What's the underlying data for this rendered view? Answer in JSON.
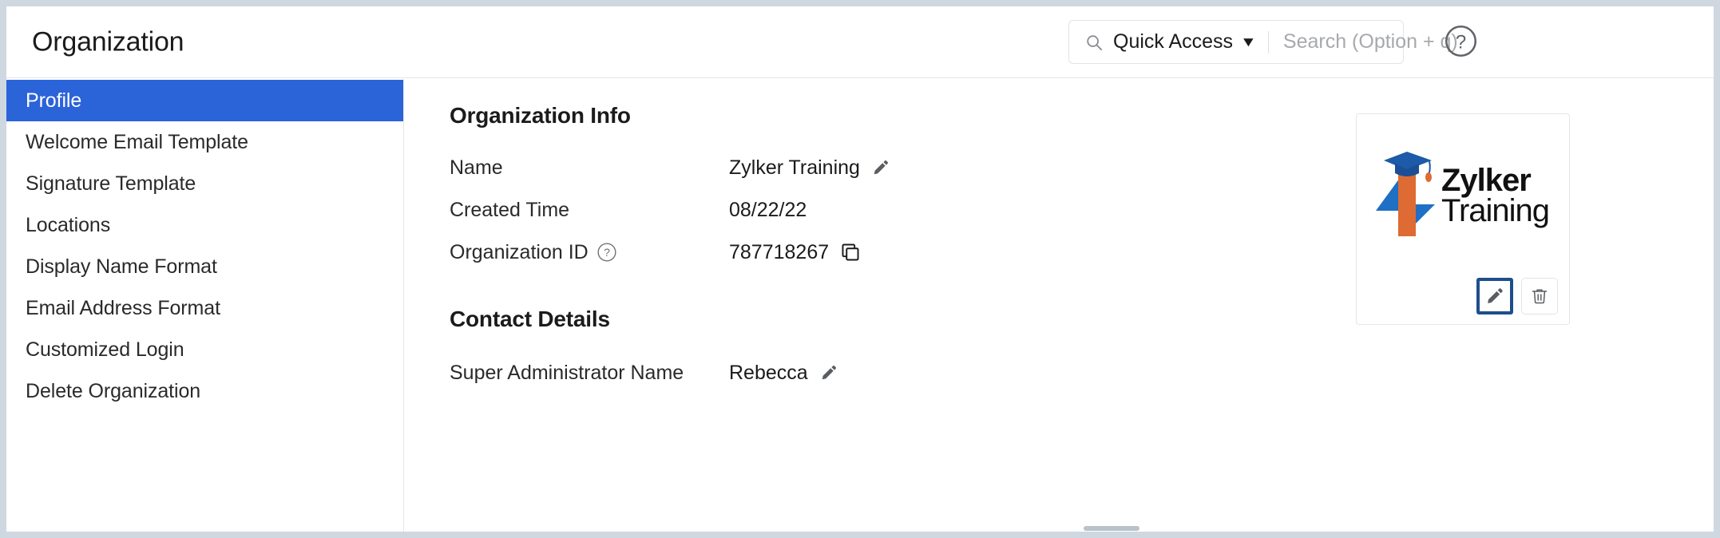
{
  "header": {
    "title": "Organization",
    "search_icon": "search-icon",
    "quick_access_label": "Quick Access",
    "quick_access_caret": "▼",
    "search_placeholder": "Search (Option + q)",
    "search_value": "",
    "help_icon": "question-mark-circle-icon"
  },
  "sidebar": {
    "items": [
      {
        "label": "Profile",
        "active": true
      },
      {
        "label": "Welcome Email Template",
        "active": false
      },
      {
        "label": "Signature Template",
        "active": false
      },
      {
        "label": "Locations",
        "active": false
      },
      {
        "label": "Display Name Format",
        "active": false
      },
      {
        "label": "Email Address Format",
        "active": false
      },
      {
        "label": "Customized Login",
        "active": false
      },
      {
        "label": "Delete Organization",
        "active": false
      }
    ]
  },
  "main": {
    "org_info": {
      "title": "Organization Info",
      "fields": [
        {
          "label": "Name",
          "value": "Zylker Training",
          "edit_icon": "pencil-icon"
        },
        {
          "label": "Created Time",
          "value": "08/22/22"
        },
        {
          "label": "Organization ID",
          "help_icon": "question-mark-circle-icon",
          "value": "787718267",
          "copy_icon": "copy-icon"
        }
      ]
    },
    "contact_details": {
      "title": "Contact Details",
      "fields": [
        {
          "label": "Super Administrator Name",
          "value": "Rebecca",
          "edit_icon": "pencil-icon"
        }
      ]
    },
    "logo_card": {
      "wordmark_line1": "Zylker",
      "wordmark_line2": "Training",
      "edit_icon": "pencil-icon",
      "delete_icon": "trash-icon"
    }
  },
  "colors": {
    "accent_blue": "#2b63d9",
    "focus_outline": "#1f4e8c",
    "logo_blue": "#1f6fc4",
    "logo_cap_blue": "#1d5aa8",
    "logo_orange": "#dd6b33",
    "page_border": "#cfd8e0",
    "divider": "#e4e6e8"
  }
}
